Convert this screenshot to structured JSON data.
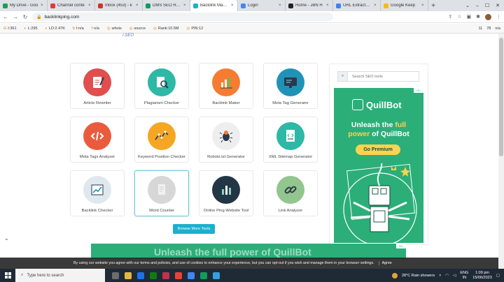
{
  "browser": {
    "tabs": [
      {
        "label": "My Drive - Goo",
        "color": "#1a9e55",
        "active": false
      },
      {
        "label": "Channel conte",
        "color": "#e53935",
        "active": false
      },
      {
        "label": "Inbox (453) - k",
        "color": "#d93025",
        "active": false
      },
      {
        "label": "DMS SEO Repo",
        "color": "#0f9d58",
        "active": false
      },
      {
        "label": "Backlink Mass I",
        "color": "#1bb0cf",
        "active": true
      },
      {
        "label": "Login",
        "color": "#4285f4",
        "active": false
      },
      {
        "label": "Home - JBN H",
        "color": "#222222",
        "active": false
      },
      {
        "label": "URL Extractor C",
        "color": "#3b82f6",
        "active": false
      },
      {
        "label": "Google Keep",
        "color": "#fbbc04",
        "active": false
      }
    ],
    "tab_close": "×",
    "new_tab": "+",
    "window_controls": [
      "⌄",
      "–",
      "☐",
      "✕"
    ],
    "url": "backlinkping.com",
    "nav": {
      "back": "←",
      "forward": "→",
      "reload": "↻"
    }
  },
  "seo_toolbar": {
    "items": [
      {
        "icon": "G",
        "label": "I:361"
      },
      {
        "icon": "◐",
        "label": "L:295"
      },
      {
        "icon": "◐",
        "label": "LD:2.47K"
      },
      {
        "icon": "b",
        "label": "I:n/a"
      },
      {
        "icon": "f",
        "label": "n/a"
      },
      {
        "icon": "◎",
        "label": "whois"
      },
      {
        "icon": "◎",
        "label": "source"
      },
      {
        "icon": "◎",
        "label": "Rank:10.5M"
      },
      {
        "icon": "◎",
        "label": "PIN:12"
      }
    ],
    "right_items": [
      "11",
      "78",
      "n/a"
    ]
  },
  "page": {
    "logo_text": "/.SEO",
    "tools": [
      {
        "label": "Article Rewriter",
        "icon": "pen-icon",
        "color": "#e04e4e"
      },
      {
        "label": "Plagiarism Checker",
        "icon": "magnifier-document-icon",
        "color": "#2eb8a6"
      },
      {
        "label": "Backlink Maker",
        "icon": "bar-chart-icon",
        "color": "#f57c32"
      },
      {
        "label": "Meta Tag Generator",
        "icon": "monitor-icon",
        "color": "#1f93b5"
      },
      {
        "label": "Meta Tags Analyzer",
        "icon": "code-icon",
        "color": "#ea5b3e"
      },
      {
        "label": "Keyword Position Checker",
        "icon": "line-chart-icon",
        "color": "#f5a623"
      },
      {
        "label": "Robots.txt Generator",
        "icon": "bug-icon",
        "color": "#eeeeee"
      },
      {
        "label": "XML Sitemap Generator",
        "icon": "file-code-icon",
        "color": "#2eb8a6"
      },
      {
        "label": "Backlink Checker",
        "icon": "trend-chart-icon",
        "color": "#dfe8ef"
      },
      {
        "label": "Word Counter",
        "icon": "document-icon",
        "color": "#d7d7d7"
      },
      {
        "label": "Online Ping Website Tool",
        "icon": "ping-bars-icon",
        "color": "#233645"
      },
      {
        "label": "Link Analyzer",
        "icon": "link-icon",
        "color": "#93c58e"
      }
    ],
    "browse_button": "Browse More Tools",
    "search_placeholder": "Search SEO tools"
  },
  "sidebar_ad": {
    "brand": "QuillBot",
    "headline_1": "Unleash the",
    "headline_hl_1": "full",
    "headline_2": "power",
    "headline_3": "of QuillBot",
    "cta": "Go Premium",
    "adchoice": "D▷"
  },
  "bottom_ad": {
    "text": "Unleash the full power of QuillBot"
  },
  "cookie": {
    "text": "By using our website you agree with our terms and policies, and use of cookies to enhance your experience, but you can opt-out if you wish and manage them in your browser settings.",
    "agree": "Agree"
  },
  "taskbar": {
    "search_placeholder": "Type here to search",
    "weather": "28°C  Rain showers",
    "lang_1": "ENG",
    "lang_2": "IN",
    "time": "1:09 pm",
    "date": "15/06/2023",
    "apps": [
      "#6d6d6d",
      "#e8b640",
      "#1a73e8",
      "#107c10",
      "#c4314b",
      "#ea4335",
      "#4285f4",
      "#0f9d58",
      "#34a0e0"
    ]
  }
}
